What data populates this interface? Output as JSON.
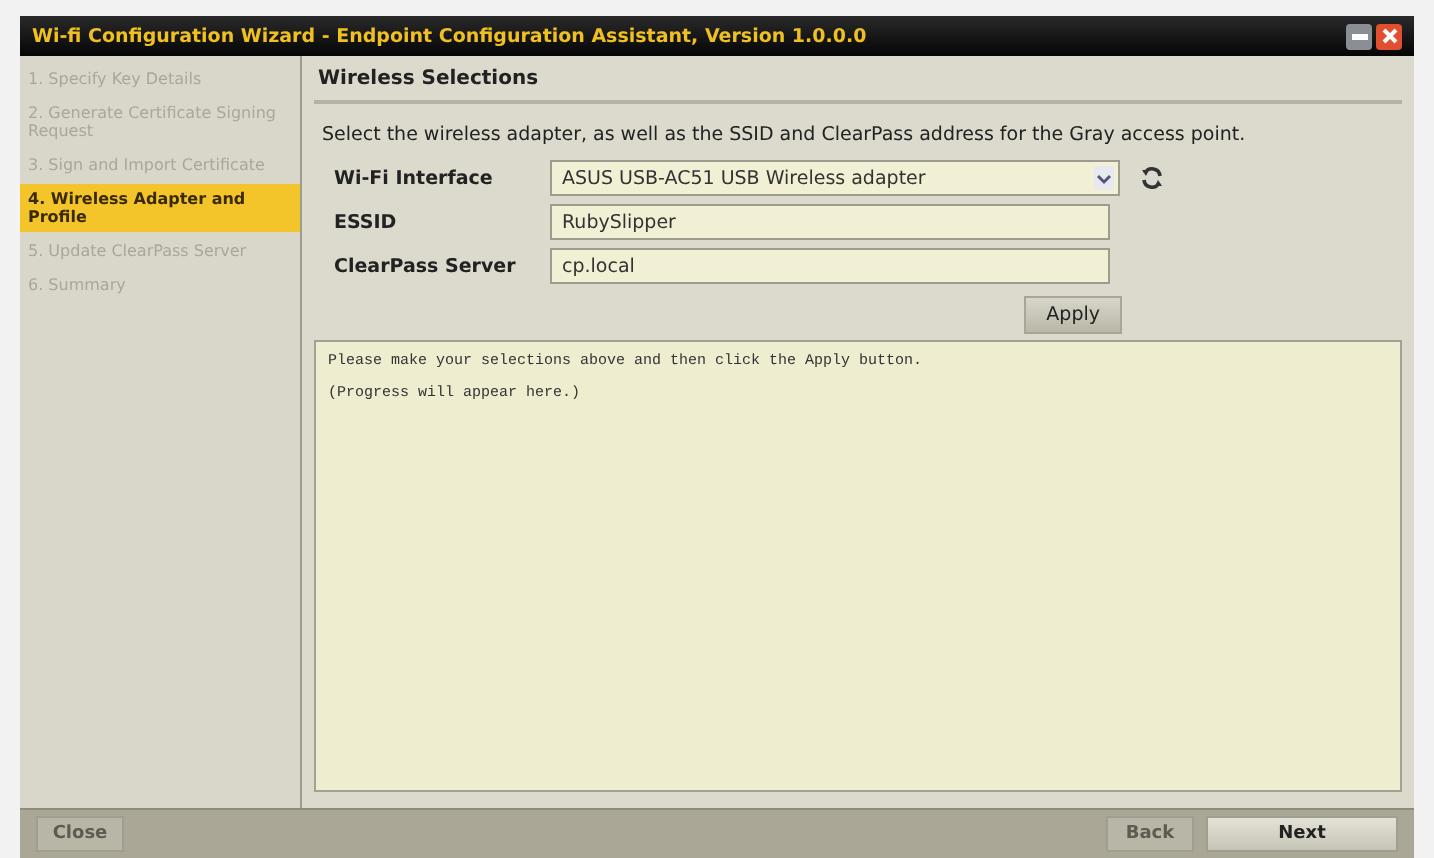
{
  "window": {
    "title": "Wi-fi Configuration Wizard - Endpoint Configuration Assistant, Version 1.0.0.0"
  },
  "steps": [
    {
      "label": "1. Specify Key Details",
      "selected": false
    },
    {
      "label": "2. Generate Certificate Signing Request",
      "selected": false
    },
    {
      "label": "3. Sign and Import Certificate",
      "selected": false
    },
    {
      "label": "4. Wireless Adapter and Profile",
      "selected": true
    },
    {
      "label": "5. Update ClearPass Server",
      "selected": false
    },
    {
      "label": "6. Summary",
      "selected": false
    }
  ],
  "section": {
    "title": "Wireless Selections",
    "instructions": "Select the wireless adapter, as well as the SSID and ClearPass address for the Gray access point."
  },
  "fields": [
    {
      "kind": "select",
      "label": "Wi-Fi Interface",
      "value": "ASUS USB-AC51 USB Wireless adapter"
    },
    {
      "kind": "text",
      "label": "ESSID",
      "value": "RubySlipper"
    },
    {
      "kind": "text",
      "label": "ClearPass Server",
      "value": "cp.local"
    }
  ],
  "apply_button": {
    "label": "Apply",
    "disabled": false
  },
  "log": [
    "Please make your selections above and then click the Apply button.",
    "(Progress will appear here.)"
  ],
  "footer_buttons": [
    {
      "label": "Close",
      "disabled": true
    },
    {
      "label": "Back",
      "disabled": true
    },
    {
      "label": "Next",
      "disabled": false
    }
  ]
}
